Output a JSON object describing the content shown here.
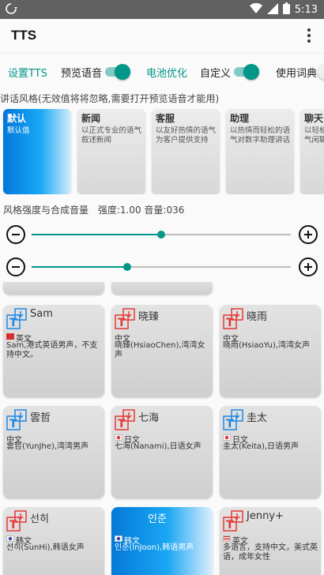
{
  "statusbar": {
    "left_icon": "sync-icon",
    "time": "5:13",
    "icons": [
      "wifi-icon",
      "signal-icon",
      "battery-icon"
    ]
  },
  "appbar": {
    "title": "TTS",
    "menu_icon": "more-vert-icon"
  },
  "toolbar": {
    "setup_tts": "设置TTS",
    "preview_voice": "预览语音",
    "battery_opt": "电池优化",
    "custom": "自定义",
    "use_dict": "使用词典",
    "preview_switch_on": true,
    "custom_switch_on": true
  },
  "style_hint": "讲话风格(无效值将将忽略,需要打开预览语音才能用)",
  "styles": [
    {
      "name": "默认",
      "desc": "默认值",
      "selected": true
    },
    {
      "name": "新闻",
      "desc": "以正式专业的语气叙述新闻"
    },
    {
      "name": "客服",
      "desc": "以友好热情的语气为客户提供支持"
    },
    {
      "name": "助理",
      "desc": "以热情而轻松的语气对数字助理讲话"
    },
    {
      "name": "聊天",
      "desc": "以轻松、随意的语气闲聊"
    }
  ],
  "strength_label": "风格强度与合成音量",
  "strength_value": "强度:1.00 音量:036",
  "sliders": {
    "strength_fraction": 0.5,
    "volume_fraction": 0.37
  },
  "voices": [
    {
      "name": "Sam",
      "lang": "英文",
      "desc": "Sam,港式英语男声，不支持中文。"
    },
    {
      "name": "晓臻",
      "lang": "中文",
      "desc": "晓臻(HsiaoChen),湾湾女声"
    },
    {
      "name": "晓雨",
      "lang": "中文",
      "desc": "晓雨(HsiaoYu),湾湾女声"
    },
    {
      "name": "雲哲",
      "lang": "中文",
      "desc": "雲哲(YunJhe),湾湾男声"
    },
    {
      "name": "七海",
      "lang": "日文",
      "desc": "七海(Nanami),日语女声"
    },
    {
      "name": "圭太",
      "lang": "日文",
      "desc": "圭太(Keita),日语男声"
    },
    {
      "name": "선히",
      "lang": "韩文",
      "desc": "선히(SunHi),韩语女声"
    },
    {
      "name": "인준",
      "lang": "韩文",
      "desc": "인준(InJoon),韩语男声"
    },
    {
      "name": "Jenny+",
      "lang": "英文",
      "desc": "多语言，支持中文，美式英语，成年女性"
    }
  ],
  "colors": {
    "accent": "#009688",
    "statusbar": "#616161",
    "selected_blue": "#0277d9",
    "icon_red": "#e53935",
    "icon_blue": "#1e88e5"
  }
}
